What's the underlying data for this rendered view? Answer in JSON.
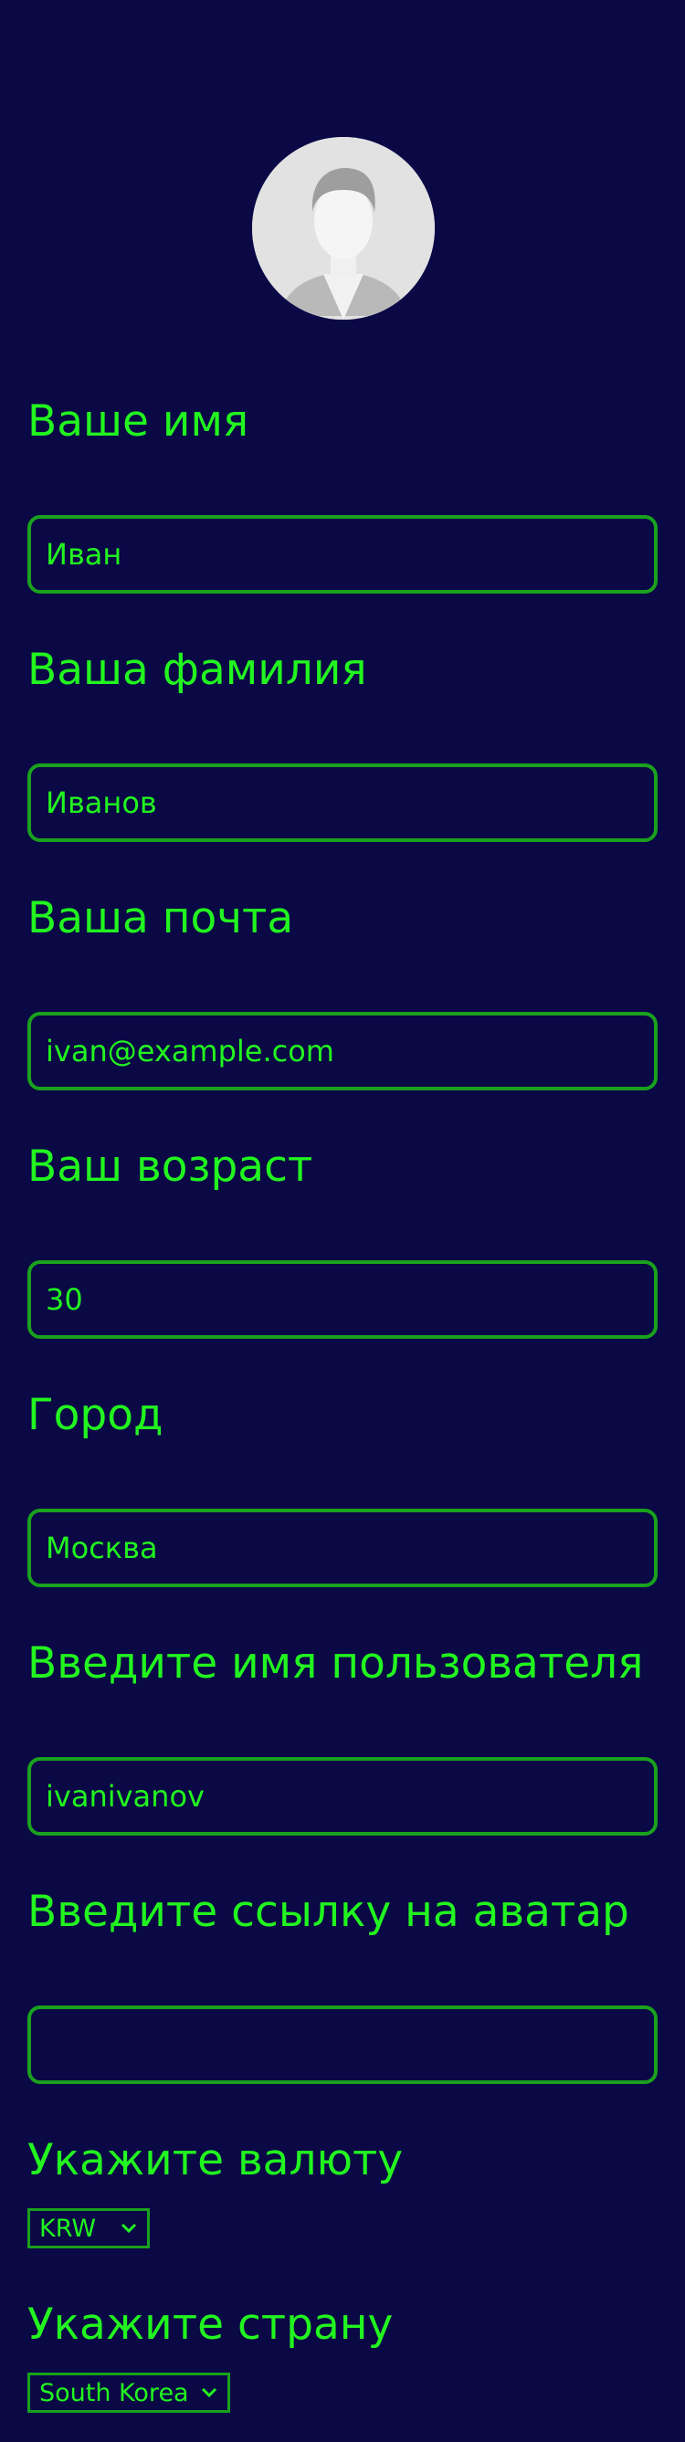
{
  "profile": {
    "avatar": "avatar-placeholder-person",
    "fields": [
      {
        "label": "Ваше имя",
        "value": "Иван"
      },
      {
        "label": "Ваша фамилия",
        "value": "Иванов"
      },
      {
        "label": "Ваша почта",
        "value": "ivan@example.com"
      },
      {
        "label": "Ваш возраст",
        "value": "30"
      },
      {
        "label": "Город",
        "value": "Москва"
      },
      {
        "label": "Введите имя пользователя",
        "value": "ivanivanov"
      },
      {
        "label": "Введите ссылку на аватар",
        "value": ""
      }
    ],
    "currency": {
      "label": "Укажите валюту",
      "selected": "KRW"
    },
    "country": {
      "label": "Укажите страну",
      "selected": "South Korea"
    }
  },
  "colors": {
    "background": "#0a0845",
    "accent": "#22f51f",
    "border": "#1aa11d"
  },
  "icons": {
    "select_arrow": "chevron-down-icon"
  }
}
